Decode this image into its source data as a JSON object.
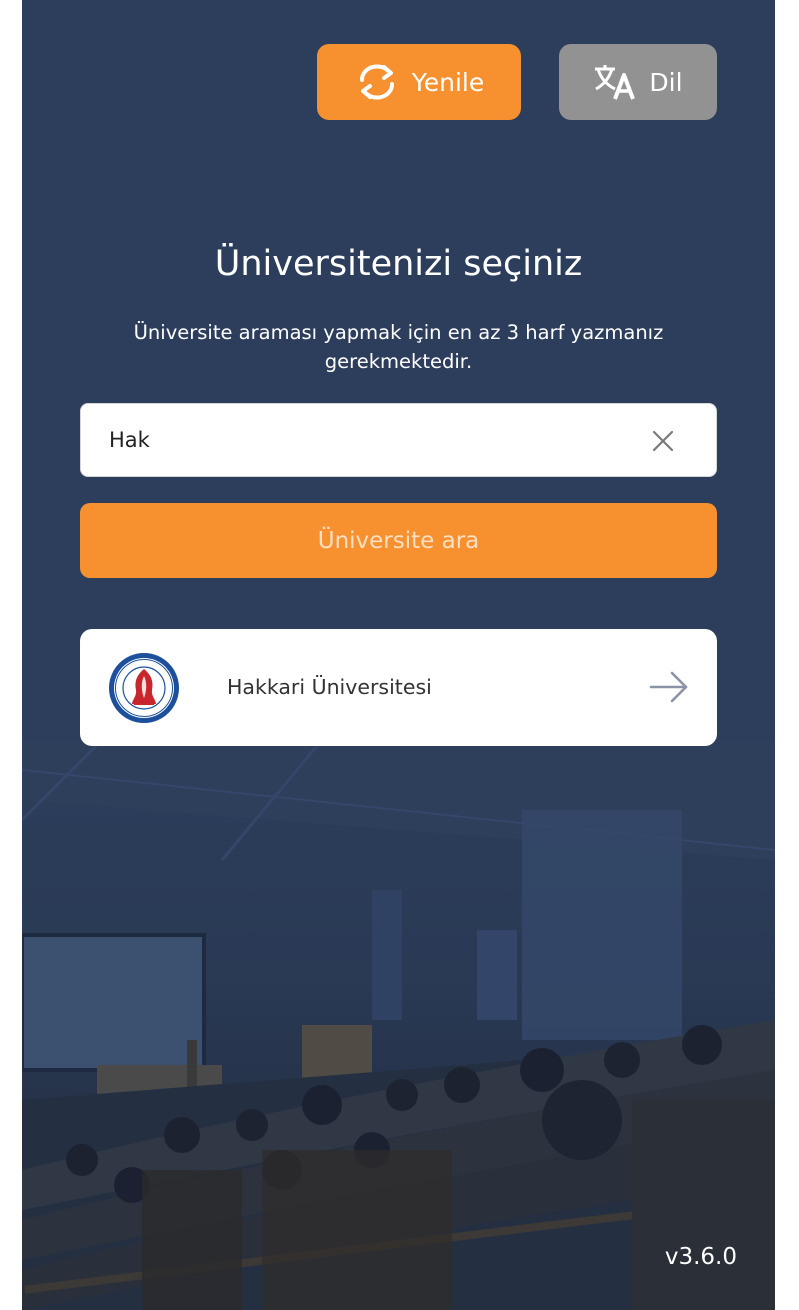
{
  "header": {
    "refresh_label": "Yenile",
    "language_label": "Dil"
  },
  "main": {
    "title": "Üniversitenizi seçiniz",
    "subtitle": "Üniversite araması yapmak için en az 3 harf yazmanız gerekmektedir."
  },
  "search": {
    "value": "Hak",
    "button_label": "Üniversite ara"
  },
  "results": [
    {
      "name": "Hakkari Üniversitesi",
      "icon": "university-logo"
    }
  ],
  "footer": {
    "version": "v3.6.0"
  },
  "colors": {
    "background": "#2c3e5c",
    "accent": "#f7912f",
    "secondary_button": "#929292"
  }
}
